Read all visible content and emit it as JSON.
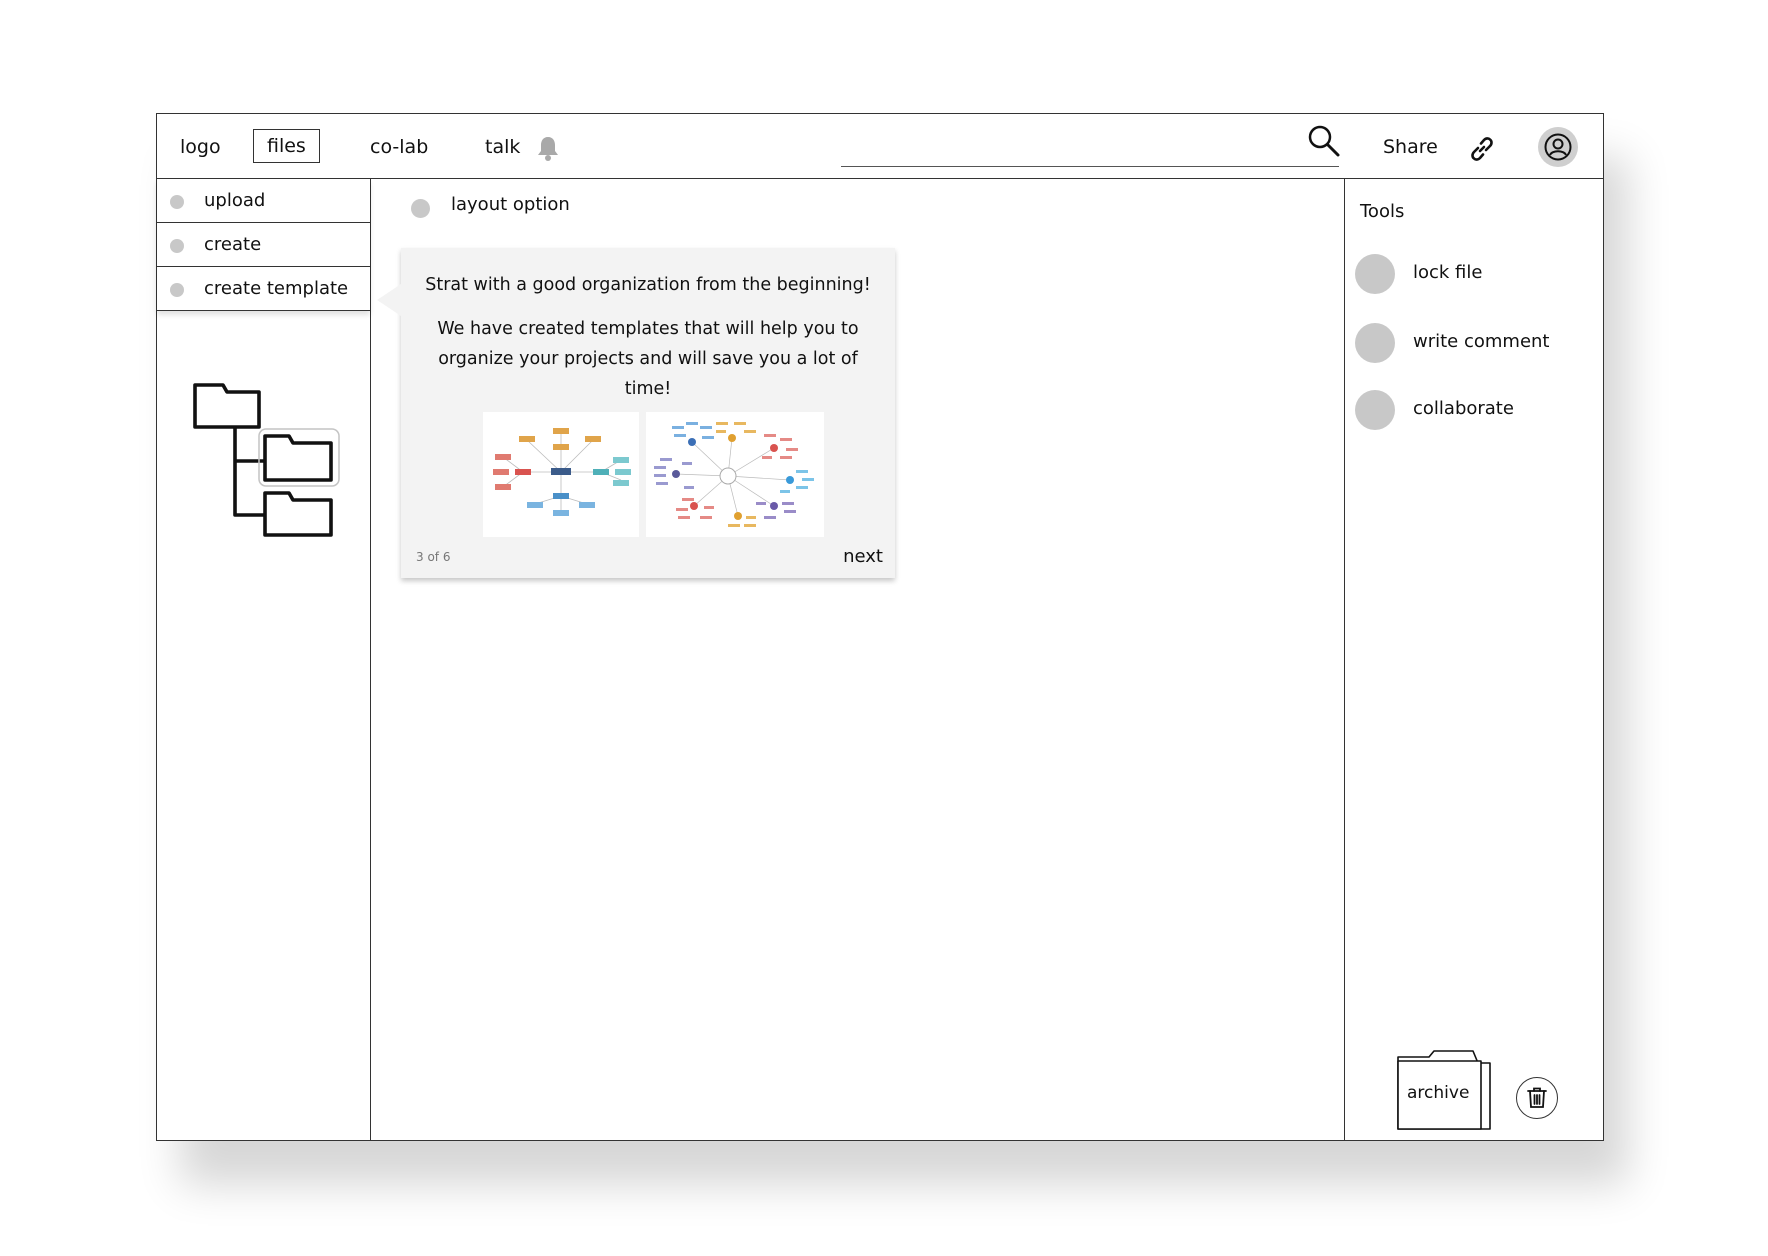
{
  "topbar": {
    "nav": [
      {
        "label": "logo"
      },
      {
        "label": "files",
        "selected": true
      },
      {
        "label": "co-lab"
      },
      {
        "label": "talk"
      }
    ],
    "notification_icon": "bell-icon",
    "search_icon": "search-icon",
    "share_label": "Share",
    "link_icon": "link-icon",
    "avatar_icon": "user-avatar-icon"
  },
  "sidebar": {
    "items": [
      {
        "label": "upload"
      },
      {
        "label": "create"
      },
      {
        "label": "create template"
      }
    ],
    "folder_tree_icon": "folder-tree-icon"
  },
  "main": {
    "layout_option_label": "layout option",
    "popover": {
      "title": "Strat with a good organization from the beginning!",
      "body": "We have created templates that will help you to organize your projects and will save you a lot of time!",
      "thumbnails": [
        "mind-map-template-thumbnail",
        "radial-mind-map-template-thumbnail"
      ],
      "page_indicator": "3 of 6",
      "next_label": "next"
    }
  },
  "tools": {
    "title": "Tools",
    "items": [
      {
        "label": "lock file"
      },
      {
        "label": "write comment"
      },
      {
        "label": "collaborate"
      }
    ],
    "archive_label": "archive",
    "trash_icon": "trash-icon"
  }
}
